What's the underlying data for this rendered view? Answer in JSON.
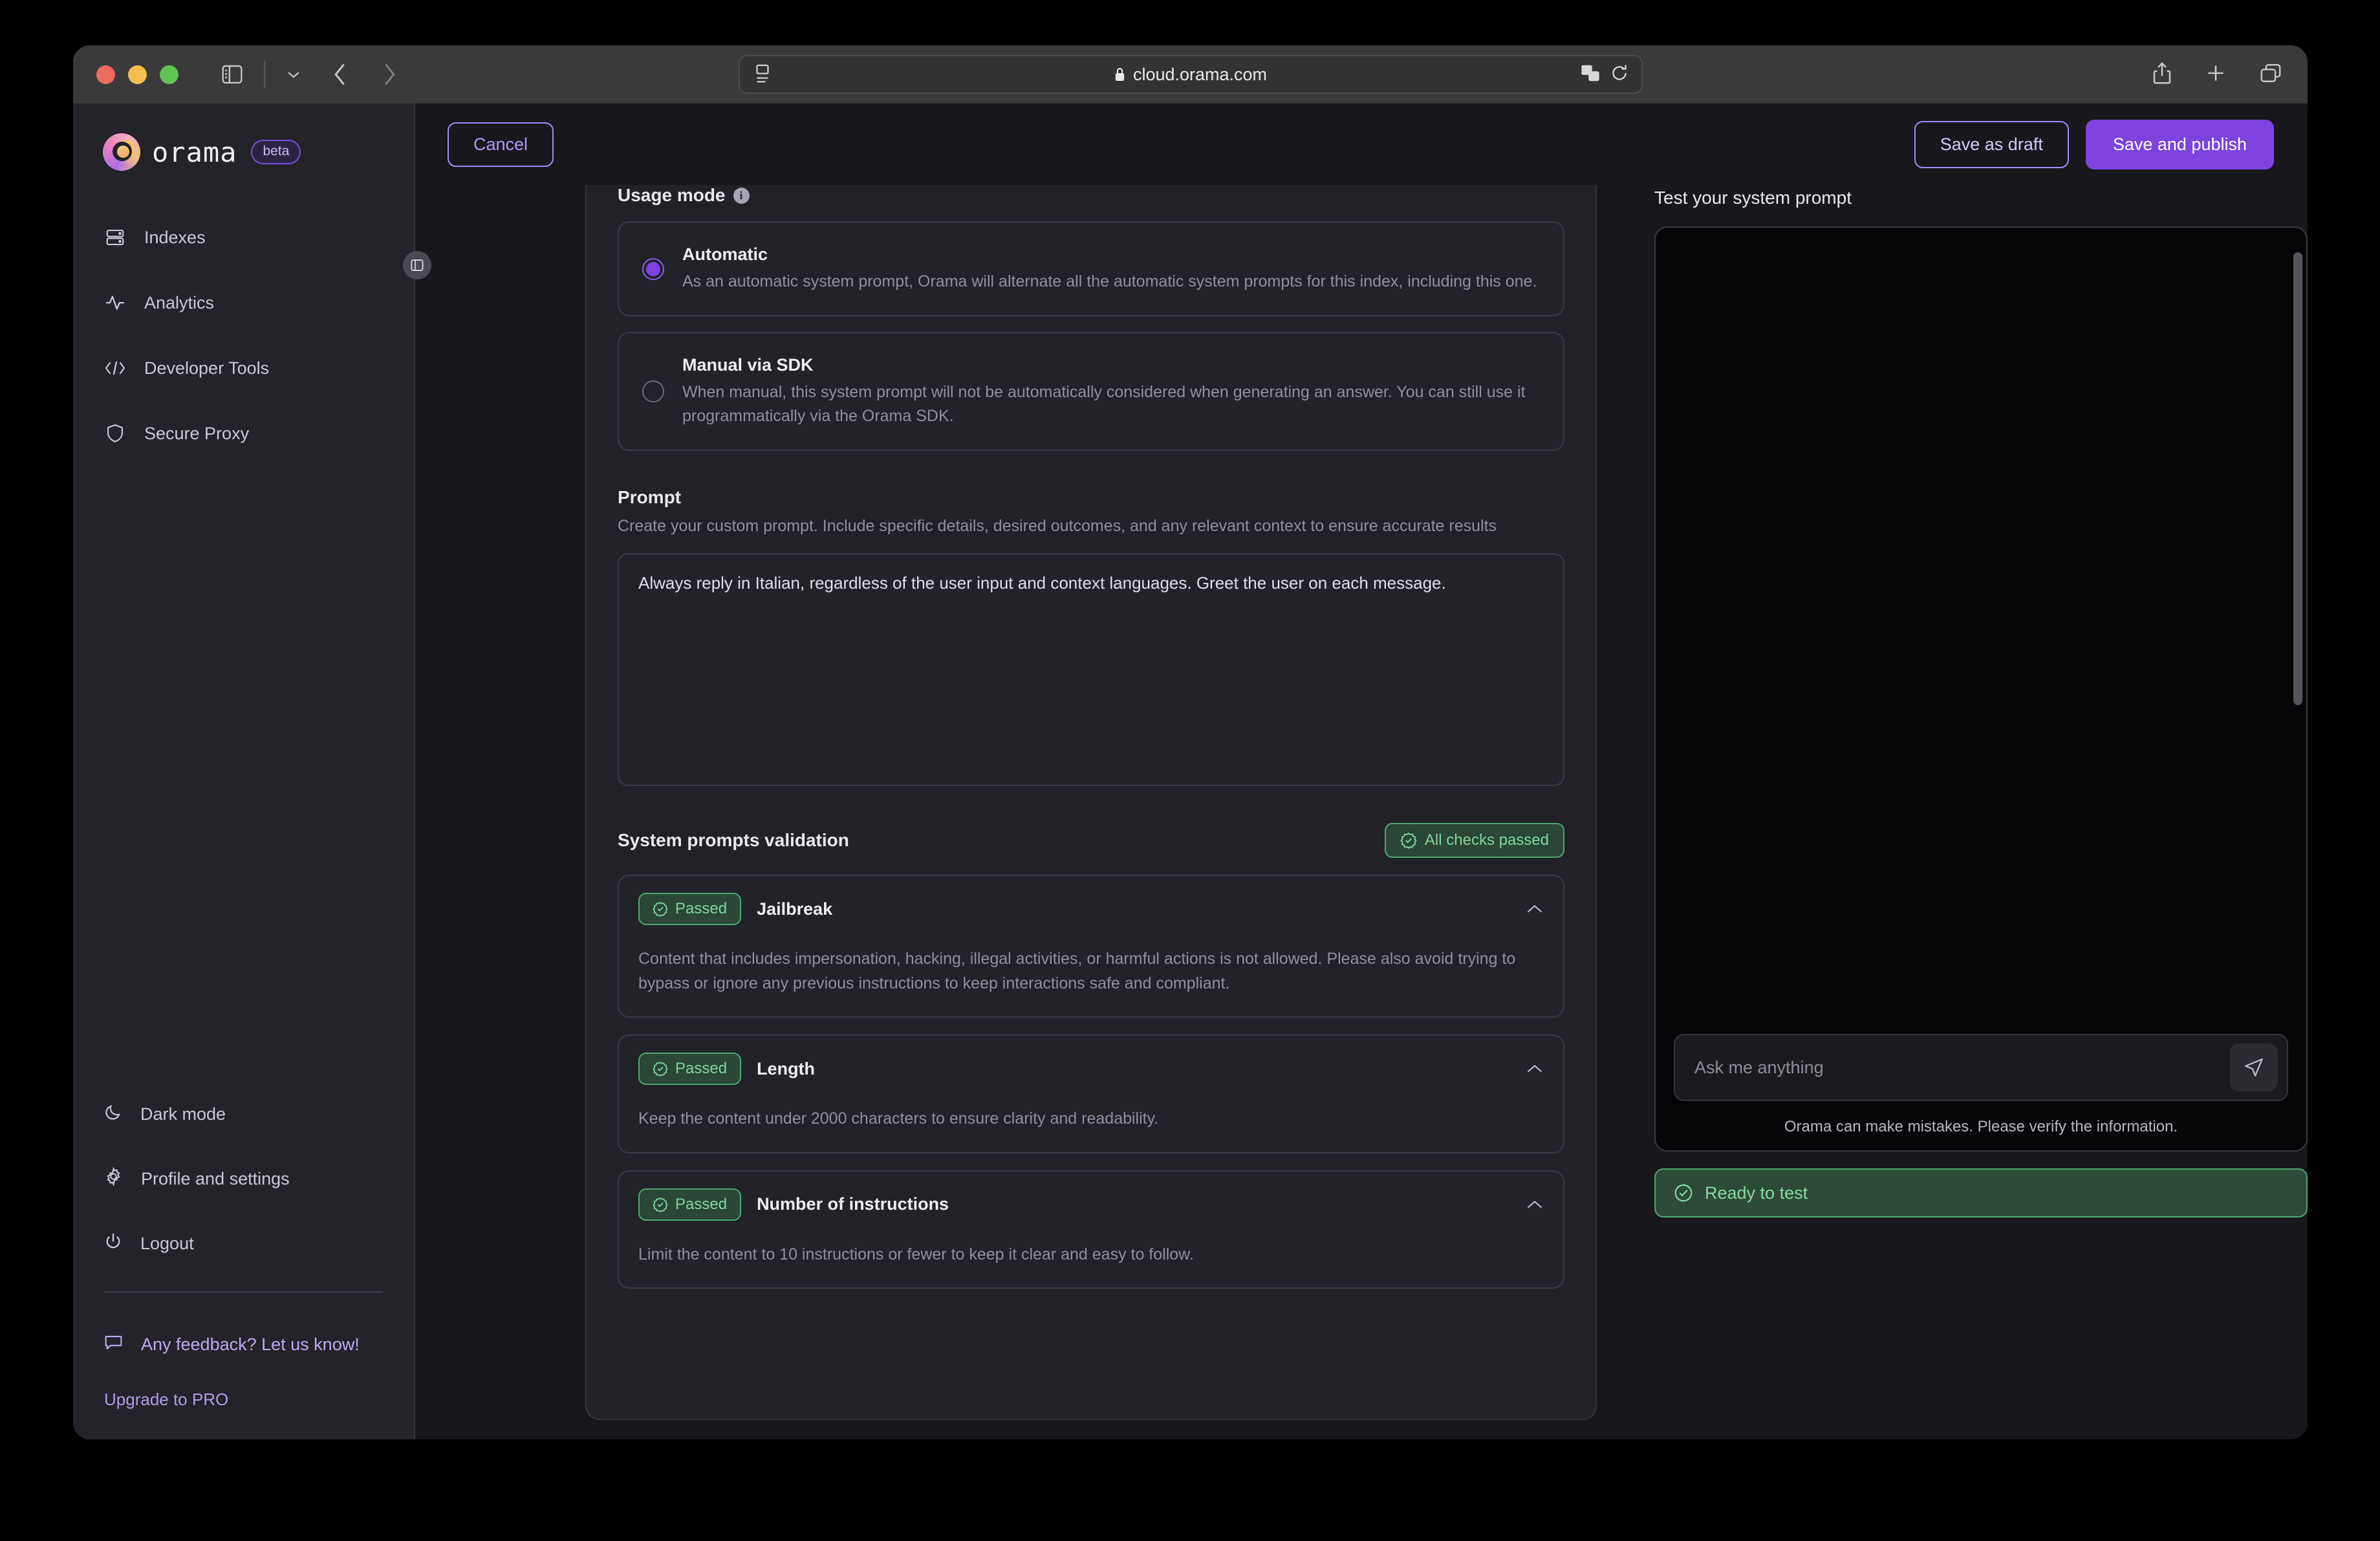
{
  "browser": {
    "url": "cloud.orama.com",
    "lock_icon": "lock-icon",
    "reader_icon": "reader-view-icon",
    "translate_icon": "translate-icon",
    "reload_icon": "reload-icon",
    "sidebar_icon": "sidebar-toggle-icon",
    "tabgroup_icon": "chevron-down-icon",
    "back_icon": "back-arrow-icon",
    "forward_icon": "forward-arrow-icon",
    "share_icon": "share-icon",
    "newtab_icon": "plus-icon",
    "tabs_icon": "tab-overview-icon"
  },
  "sidebar": {
    "brand": "orama",
    "badge": "beta",
    "items": [
      {
        "label": "Indexes",
        "icon": "server-icon"
      },
      {
        "label": "Analytics",
        "icon": "activity-icon"
      },
      {
        "label": "Developer Tools",
        "icon": "code-icon"
      },
      {
        "label": "Secure Proxy",
        "icon": "shield-icon"
      }
    ],
    "bottom_items": [
      {
        "label": "Dark mode",
        "icon": "moon-icon"
      },
      {
        "label": "Profile and settings",
        "icon": "gear-icon"
      },
      {
        "label": "Logout",
        "icon": "power-icon"
      }
    ],
    "feedback": {
      "label": "Any feedback? Let us know!",
      "icon": "message-icon"
    },
    "upgrade": "Upgrade to PRO"
  },
  "topbar": {
    "cancel": "Cancel",
    "save_draft": "Save as draft",
    "save_publish": "Save and publish"
  },
  "form": {
    "usage_mode_label": "Usage mode",
    "options": [
      {
        "title": "Automatic",
        "desc": "As an automatic system prompt, Orama will alternate all the automatic system prompts for this index, including this one.",
        "selected": true
      },
      {
        "title": "Manual via SDK",
        "desc": "When manual, this system prompt will not be automatically considered when generating an answer. You can still use it programmatically via the Orama SDK.",
        "selected": false
      }
    ],
    "prompt_label": "Prompt",
    "prompt_help": "Create your custom prompt. Include specific details, desired outcomes, and any relevant context to ensure accurate results",
    "prompt_value": "Always reply in Italian, regardless of the user input and context languages. Greet the user on each message."
  },
  "validation": {
    "title": "System prompts validation",
    "all_passed_label": "All checks passed",
    "checks": [
      {
        "status": "Passed",
        "name": "Jailbreak",
        "desc": "Content that includes impersonation, hacking, illegal activities, or harmful actions is not allowed. Please also avoid trying to bypass or ignore any previous instructions to keep interactions safe and compliant."
      },
      {
        "status": "Passed",
        "name": "Length",
        "desc": "Keep the content under 2000 characters to ensure clarity and readability."
      },
      {
        "status": "Passed",
        "name": "Number of instructions",
        "desc": "Limit the content to 10 instructions or fewer to keep it clear and easy to follow."
      }
    ]
  },
  "test_panel": {
    "title": "Test your system prompt",
    "input_placeholder": "Ask me anything",
    "disclaimer": "Orama can make mistakes. Please verify the information.",
    "status": "Ready to test",
    "send_icon": "send-icon",
    "status_icon": "circle-check-icon"
  },
  "colors": {
    "accent": "#7c43e0",
    "accent_light": "#a78bfa",
    "success": "#4ea870",
    "success_text": "#7fd69c"
  }
}
